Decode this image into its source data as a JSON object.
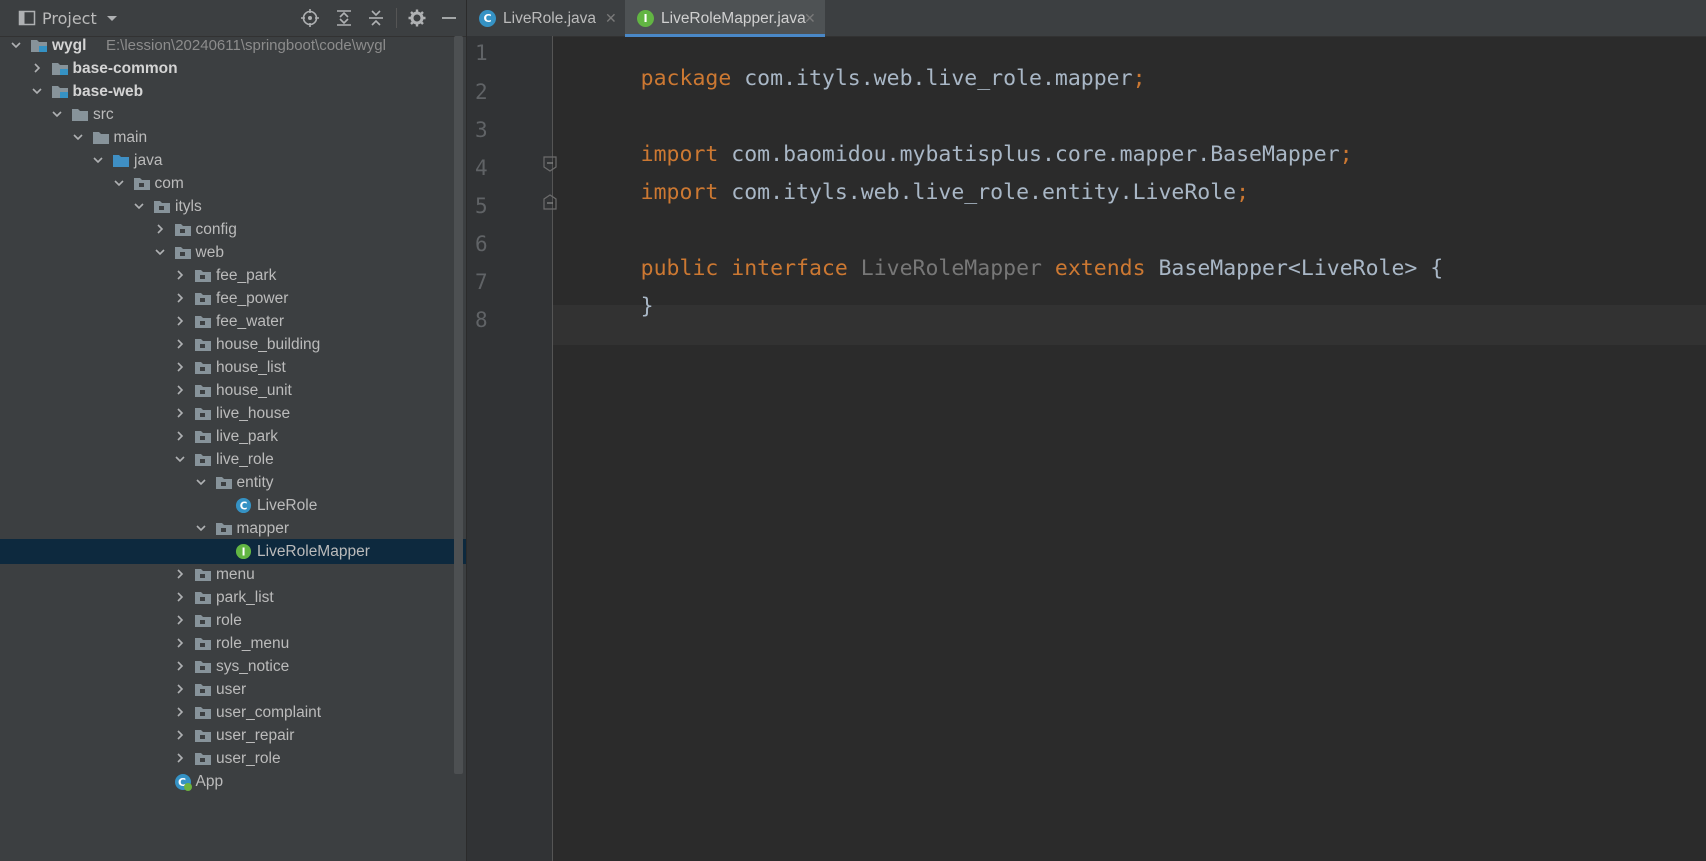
{
  "project_panel": {
    "title": "Project",
    "tree": [
      {
        "label": "wygl",
        "path": "E:\\lession\\20240611\\springboot\\code\\wygl",
        "bold": true,
        "icon": "module-folder-icon",
        "expanded": true
      },
      {
        "label": "base-common",
        "bold": true,
        "icon": "module-folder-icon",
        "expanded": false
      },
      {
        "label": "base-web",
        "bold": true,
        "icon": "module-folder-icon",
        "expanded": true
      },
      {
        "label": "src",
        "icon": "folder-icon",
        "expanded": true
      },
      {
        "label": "main",
        "icon": "folder-icon",
        "expanded": true
      },
      {
        "label": "java",
        "icon": "source-root-folder-icon",
        "expanded": true
      },
      {
        "label": "com",
        "icon": "package-icon",
        "expanded": true
      },
      {
        "label": "ityls",
        "icon": "package-icon",
        "expanded": true
      },
      {
        "label": "config",
        "icon": "package-icon",
        "expanded": false
      },
      {
        "label": "web",
        "icon": "package-icon",
        "expanded": true
      },
      {
        "label": "fee_park",
        "icon": "package-icon",
        "expanded": false
      },
      {
        "label": "fee_power",
        "icon": "package-icon",
        "expanded": false
      },
      {
        "label": "fee_water",
        "icon": "package-icon",
        "expanded": false
      },
      {
        "label": "house_building",
        "icon": "package-icon",
        "expanded": false
      },
      {
        "label": "house_list",
        "icon": "package-icon",
        "expanded": false
      },
      {
        "label": "house_unit",
        "icon": "package-icon",
        "expanded": false
      },
      {
        "label": "live_house",
        "icon": "package-icon",
        "expanded": false
      },
      {
        "label": "live_park",
        "icon": "package-icon",
        "expanded": false
      },
      {
        "label": "live_role",
        "icon": "package-icon",
        "expanded": true
      },
      {
        "label": "entity",
        "icon": "package-icon",
        "expanded": true
      },
      {
        "label": "LiveRole",
        "icon": "class-icon"
      },
      {
        "label": "mapper",
        "icon": "package-icon",
        "expanded": true
      },
      {
        "label": "LiveRoleMapper",
        "icon": "interface-icon",
        "selected": true
      },
      {
        "label": "menu",
        "icon": "package-icon",
        "expanded": false
      },
      {
        "label": "park_list",
        "icon": "package-icon",
        "expanded": false
      },
      {
        "label": "role",
        "icon": "package-icon",
        "expanded": false
      },
      {
        "label": "role_menu",
        "icon": "package-icon",
        "expanded": false
      },
      {
        "label": "sys_notice",
        "icon": "package-icon",
        "expanded": false
      },
      {
        "label": "user",
        "icon": "package-icon",
        "expanded": false
      },
      {
        "label": "user_complaint",
        "icon": "package-icon",
        "expanded": false
      },
      {
        "label": "user_repair",
        "icon": "package-icon",
        "expanded": false
      },
      {
        "label": "user_role",
        "icon": "package-icon",
        "expanded": false
      },
      {
        "label": "App",
        "icon": "spring-app-class-icon"
      }
    ]
  },
  "editor": {
    "tabs": [
      {
        "label": "LiveRole.java",
        "icon": "class-icon",
        "active": false
      },
      {
        "label": "LiveRoleMapper.java",
        "icon": "interface-icon",
        "active": true
      }
    ],
    "line_numbers": [
      "1",
      "2",
      "3",
      "4",
      "5",
      "6",
      "7",
      "8"
    ],
    "code": {
      "line1": {
        "kw": "package",
        "rest": "com.ityls.web.live_role.mapper",
        "semi": ";"
      },
      "line3": {
        "kw": "import",
        "rest": "com.baomidou.mybatisplus.core.mapper.BaseMapper",
        "semi": ";"
      },
      "line4": {
        "kw": "import",
        "rest": "com.ityls.web.live_role.entity.LiveRole",
        "semi": ";"
      },
      "line6": {
        "kw1": "public",
        "kw2": "interface",
        "name": "LiveRoleMapper",
        "kw3": "extends",
        "rest": "BaseMapper<LiveRole> {"
      },
      "line7": {
        "text": "}"
      }
    }
  },
  "colors": {
    "keyword": "#cc7832",
    "text": "#a9b7c6",
    "unused_name": "#777777",
    "selection": "#0d293e",
    "tab_underline": "#4a88c7"
  }
}
